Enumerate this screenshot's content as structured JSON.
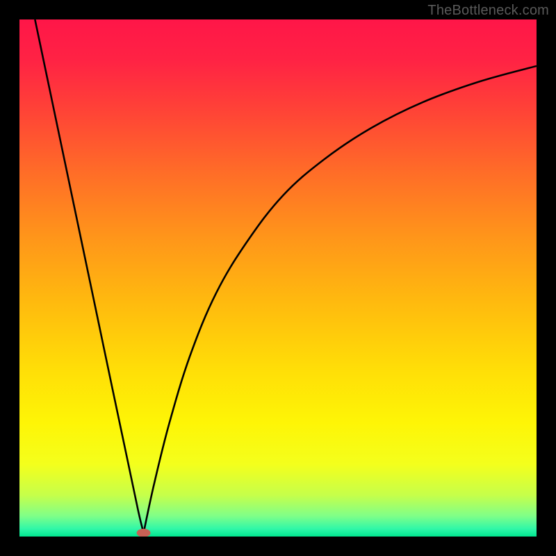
{
  "watermark": {
    "text": "TheBottleneck.com"
  },
  "gradient": {
    "stops": [
      {
        "offset": 0.0,
        "color": "#ff1648"
      },
      {
        "offset": 0.08,
        "color": "#ff2344"
      },
      {
        "offset": 0.18,
        "color": "#ff4436"
      },
      {
        "offset": 0.3,
        "color": "#ff6e27"
      },
      {
        "offset": 0.42,
        "color": "#ff951a"
      },
      {
        "offset": 0.55,
        "color": "#ffbb0e"
      },
      {
        "offset": 0.68,
        "color": "#ffdf07"
      },
      {
        "offset": 0.78,
        "color": "#fef506"
      },
      {
        "offset": 0.86,
        "color": "#f4ff1c"
      },
      {
        "offset": 0.92,
        "color": "#c6ff4a"
      },
      {
        "offset": 0.96,
        "color": "#80ff88"
      },
      {
        "offset": 0.985,
        "color": "#30f7a8"
      },
      {
        "offset": 1.0,
        "color": "#00e58f"
      }
    ]
  },
  "chart_data": {
    "type": "line",
    "title": "",
    "xlabel": "",
    "ylabel": "",
    "xlim": [
      0,
      100
    ],
    "ylim": [
      0,
      100
    ],
    "marker": {
      "x": 24,
      "y": 0.7,
      "color": "#c86055"
    },
    "series": [
      {
        "name": "left-branch",
        "x": [
          3,
          6,
          9,
          12,
          15,
          18,
          21,
          23,
          24
        ],
        "y": [
          100,
          85.7,
          71.4,
          57.1,
          42.8,
          28.5,
          14.3,
          4.8,
          0.7
        ]
      },
      {
        "name": "right-branch",
        "x": [
          24,
          26,
          29,
          33,
          38,
          44,
          51,
          59,
          68,
          78,
          89,
          100
        ],
        "y": [
          0.7,
          10,
          22,
          35,
          47,
          57,
          66,
          73,
          79,
          84,
          88,
          91
        ]
      }
    ]
  }
}
